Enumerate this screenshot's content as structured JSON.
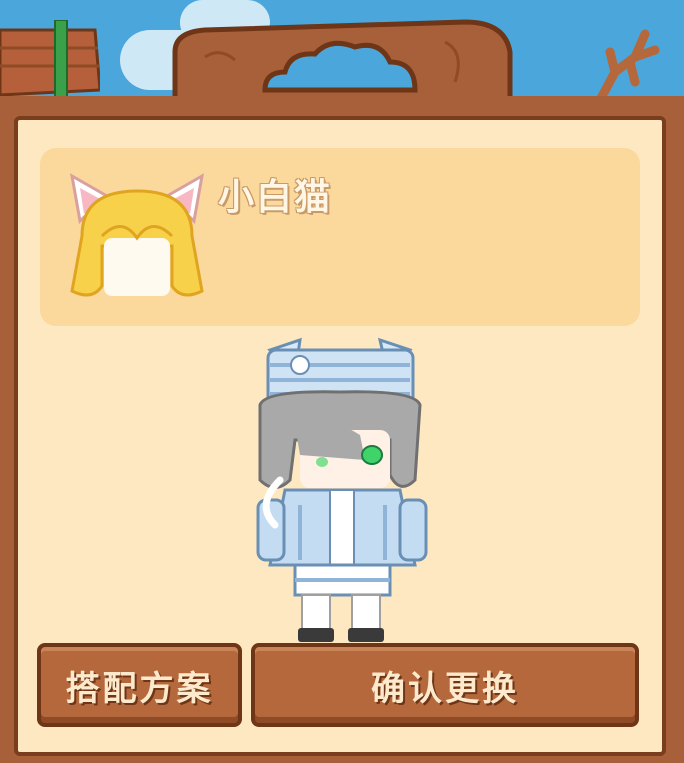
{
  "item": {
    "name": "小白猫",
    "icon": "cat-ear-hair-icon"
  },
  "buttons": {
    "outfit_label": "搭配方案",
    "confirm_label": "确认更换"
  },
  "character": {
    "icon": "avatar-character"
  },
  "colors": {
    "panel": "#fde8c2",
    "card": "#fbd89c",
    "frame": "#a8603a",
    "button": "#b5683c",
    "sky": "#4aa6db"
  }
}
